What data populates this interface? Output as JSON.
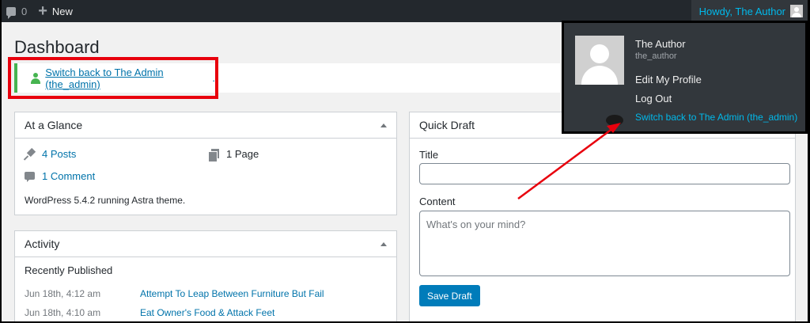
{
  "adminbar": {
    "comment_count": "0",
    "new_label": "New",
    "howdy": "Howdy, The Author"
  },
  "user_menu": {
    "display_name": "The Author",
    "username": "the_author",
    "edit_profile": "Edit My Profile",
    "log_out": "Log Out",
    "switch_back": "Switch back to The Admin (the_admin)"
  },
  "page": {
    "title": "Dashboard"
  },
  "notice": {
    "link": "Switch back to The Admin (the_admin)",
    "suffix": "."
  },
  "at_a_glance": {
    "title": "At a Glance",
    "posts": "4 Posts",
    "pages": "1 Page",
    "comments": "1 Comment",
    "version": "WordPress 5.4.2 running Astra theme."
  },
  "activity": {
    "title": "Activity",
    "subtitle": "Recently Published",
    "items": [
      {
        "date": "Jun 18th, 4:12 am",
        "title": "Attempt To Leap Between Furniture But Fail"
      },
      {
        "date": "Jun 18th, 4:10 am",
        "title": "Eat Owner's Food & Attack Feet"
      }
    ]
  },
  "quick_draft": {
    "title": "Quick Draft",
    "title_label": "Title",
    "content_label": "Content",
    "content_placeholder": "What's on your mind?",
    "save_label": "Save Draft"
  },
  "colors": {
    "adminbar_bg": "#23282d",
    "link": "#0073aa",
    "highlight_link": "#00b9eb",
    "annotation_red": "#e8000d",
    "notice_green": "#46b450",
    "button": "#007cba"
  }
}
